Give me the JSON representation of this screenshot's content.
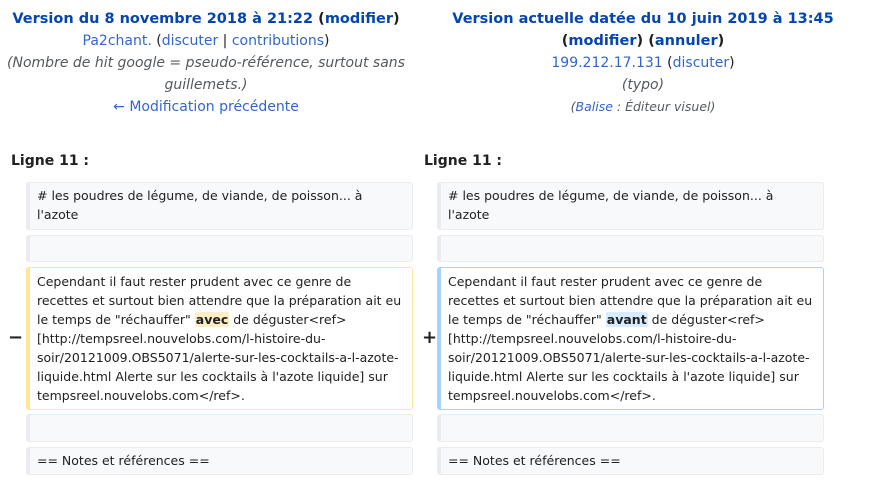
{
  "old": {
    "version_title": "Version du 8 novembre 2018 à 21:22",
    "edit_label": "modifier",
    "user": "Pa2chant.",
    "talk_label": "discuter",
    "contribs_label": "contributions",
    "comment": "(Nombre de hit google = pseudo-référence, surtout sans guillemets.)",
    "prev_edit_label": "← Modification précédente"
  },
  "new": {
    "version_title": "Version actuelle datée du 10 juin 2019 à 13:45",
    "edit_label": "modifier",
    "undo_label": "annuler",
    "user": "199.212.17.131",
    "talk_label": "discuter",
    "comment": "(typo)",
    "tags_prefix": "(",
    "tags_link": "Balise",
    "tags_rest": " : Éditeur visuel)"
  },
  "diff": {
    "line_left": "Ligne 11 :",
    "line_right": "Ligne 11 :",
    "context1": "# les poudres de légume, de viande, de poisson... à l'azote",
    "removed_marker": "−",
    "added_marker": "+",
    "changed_before": "Cependant il faut rester prudent avec ce genre de recettes et surtout bien attendre que la préparation ait eu le temps de \"réchauffer\" ",
    "removed_word": "avec",
    "added_word": "avant",
    "changed_after": " de déguster<ref>[http://tempsreel.nouvelobs.com/l-histoire-du-soir/20121009.OBS5071/alerte-sur-les-cocktails-a-l-azote-liquide.html Alerte sur les cocktails à l'azote liquide] sur tempsreel.nouvelobs.com</ref>.",
    "context3": "== Notes et références =="
  }
}
